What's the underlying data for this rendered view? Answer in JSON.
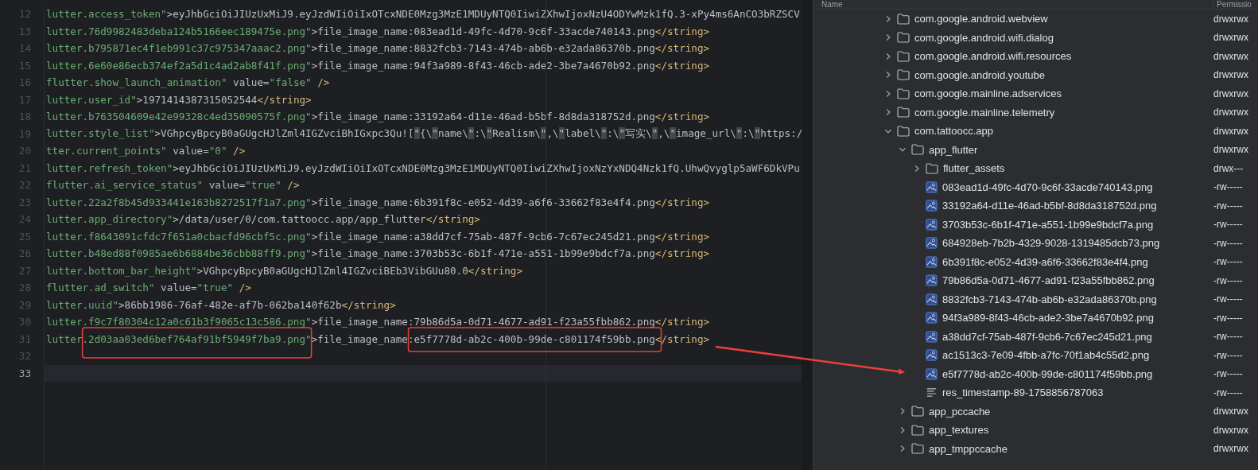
{
  "editor": {
    "lines": [
      {
        "number": "12",
        "current": false,
        "tokens": [
          {
            "kind": "attr",
            "text": "lutter.access_token\""
          },
          {
            "kind": "text",
            "text": ">eyJhbGciOiJIUzUxMiJ9.eyJzdWIiOiIxOTcxNDE0Mzg3MzE1MDUyNTQ0IiwiZXhwIjoxNzU4ODYwMzk1fQ.3-xPy4ms6AnCO3bRZSCV"
          }
        ]
      },
      {
        "number": "13",
        "current": false,
        "tokens": [
          {
            "kind": "attr",
            "text": "lutter.76d9982483deba124b5166eec189475e.png\""
          },
          {
            "kind": "text",
            "text": ">file_image_name:083ead1d-49fc-4d70-9c6f-33acde740143.png"
          },
          {
            "kind": "tag",
            "text": "</string>"
          }
        ]
      },
      {
        "number": "14",
        "current": false,
        "tokens": [
          {
            "kind": "attr",
            "text": "lutter.b795871ec4f1eb991c37c975347aaac2.png\""
          },
          {
            "kind": "text",
            "text": ">file_image_name:8832fcb3-7143-474b-ab6b-e32ada86370b.png"
          },
          {
            "kind": "tag",
            "text": "</string>"
          }
        ]
      },
      {
        "number": "15",
        "current": false,
        "tokens": [
          {
            "kind": "attr",
            "text": "lutter.6e60e86ecb374ef2a5d1c4ad2ab8f41f.png\""
          },
          {
            "kind": "text",
            "text": ">file_image_name:94f3a989-8f43-46cb-ade2-3be7a4670b92.png"
          },
          {
            "kind": "tag",
            "text": "</string>"
          }
        ]
      },
      {
        "number": "16",
        "current": false,
        "tokens": [
          {
            "kind": "attr",
            "text": "flutter.show_launch_animation\""
          },
          {
            "kind": "text",
            "text": " value="
          },
          {
            "kind": "attr",
            "text": "\"false\""
          },
          {
            "kind": "tag",
            "text": " />"
          }
        ]
      },
      {
        "number": "17",
        "current": false,
        "tokens": [
          {
            "kind": "attr",
            "text": "lutter.user_id\""
          },
          {
            "kind": "text",
            "text": ">1971414387315052544"
          },
          {
            "kind": "tag",
            "text": "</string>"
          }
        ]
      },
      {
        "number": "18",
        "current": false,
        "tokens": [
          {
            "kind": "attr",
            "text": "lutter.b763504609e42e99328c4ed35090575f.png\""
          },
          {
            "kind": "text",
            "text": ">file_image_name:33192a64-d11e-46ad-b5bf-8d8da318752d.png"
          },
          {
            "kind": "tag",
            "text": "</string>"
          }
        ]
      },
      {
        "number": "19",
        "current": false,
        "tokens": [
          {
            "kind": "attr",
            "text": "lutter.style_list\""
          },
          {
            "kind": "text",
            "text": ">VGhpcyBpcyB0aGUgcHJlZml4IGZvciBhIGxpc3Qu!["
          },
          {
            "kind": "esc",
            "text": "\""
          },
          {
            "kind": "text",
            "text": "{\\"
          },
          {
            "kind": "esc",
            "text": "\""
          },
          {
            "kind": "text",
            "text": "name\\"
          },
          {
            "kind": "esc",
            "text": "\""
          },
          {
            "kind": "text",
            "text": ":\\"
          },
          {
            "kind": "esc",
            "text": "\""
          },
          {
            "kind": "text",
            "text": "Realism\\"
          },
          {
            "kind": "esc",
            "text": "\""
          },
          {
            "kind": "text",
            "text": ",\\"
          },
          {
            "kind": "esc",
            "text": "\""
          },
          {
            "kind": "text",
            "text": "label\\"
          },
          {
            "kind": "esc",
            "text": "\""
          },
          {
            "kind": "text",
            "text": ":\\"
          },
          {
            "kind": "esc",
            "text": "\""
          },
          {
            "kind": "text",
            "text": "写实\\"
          },
          {
            "kind": "esc",
            "text": "\""
          },
          {
            "kind": "text",
            "text": ",\\"
          },
          {
            "kind": "esc",
            "text": "\""
          },
          {
            "kind": "text",
            "text": "image_url\\"
          },
          {
            "kind": "esc",
            "text": "\""
          },
          {
            "kind": "text",
            "text": ":\\"
          },
          {
            "kind": "esc",
            "text": "\""
          },
          {
            "kind": "text",
            "text": "https:/"
          }
        ]
      },
      {
        "number": "20",
        "current": false,
        "tokens": [
          {
            "kind": "attr",
            "text": "tter.current_points\""
          },
          {
            "kind": "text",
            "text": " value="
          },
          {
            "kind": "attr",
            "text": "\"0\""
          },
          {
            "kind": "tag",
            "text": " />"
          }
        ]
      },
      {
        "number": "21",
        "current": false,
        "tokens": [
          {
            "kind": "attr",
            "text": "lutter.refresh_token\""
          },
          {
            "kind": "text",
            "text": ">eyJhbGciOiJIUzUxMiJ9.eyJzdWIiOiIxOTcxNDE0Mzg3MzE1MDUyNTQ0IiwiZXhwIjoxNzYxNDQ4Nzk1fQ.UhwQvyglp5aWF6DkVPu"
          }
        ]
      },
      {
        "number": "22",
        "current": false,
        "tokens": [
          {
            "kind": "attr",
            "text": "flutter.ai_service_status\""
          },
          {
            "kind": "text",
            "text": " value="
          },
          {
            "kind": "attr",
            "text": "\"true\""
          },
          {
            "kind": "tag",
            "text": " />"
          }
        ]
      },
      {
        "number": "23",
        "current": false,
        "tokens": [
          {
            "kind": "attr",
            "text": "lutter.22a2f8b45d933441e163b8272517f1a7.png\""
          },
          {
            "kind": "text",
            "text": ">file_image_name:6b391f8c-e052-4d39-a6f6-33662f83e4f4.png"
          },
          {
            "kind": "tag",
            "text": "</string>"
          }
        ]
      },
      {
        "number": "24",
        "current": false,
        "tokens": [
          {
            "kind": "attr",
            "text": "lutter.app_directory\""
          },
          {
            "kind": "text",
            "text": ">/data/user/0/com.tattoocc.app/app_flutter"
          },
          {
            "kind": "tag",
            "text": "</string>"
          }
        ]
      },
      {
        "number": "25",
        "current": false,
        "tokens": [
          {
            "kind": "attr",
            "text": "lutter.f8643091cfdc7f651a0cbacfd96cbf5c.png\""
          },
          {
            "kind": "text",
            "text": ">file_image_name:a38dd7cf-75ab-487f-9cb6-7c67ec245d21.png"
          },
          {
            "kind": "tag",
            "text": "</string>"
          }
        ]
      },
      {
        "number": "26",
        "current": false,
        "tokens": [
          {
            "kind": "attr",
            "text": "lutter.b48ed88f0985ae6b6884be36cbb88ff9.png\""
          },
          {
            "kind": "text",
            "text": ">file_image_name:3703b53c-6b1f-471e-a551-1b99e9bdcf7a.png"
          },
          {
            "kind": "tag",
            "text": "</string>"
          }
        ]
      },
      {
        "number": "27",
        "current": false,
        "tokens": [
          {
            "kind": "attr",
            "text": "lutter.bottom_bar_height\""
          },
          {
            "kind": "text",
            "text": ">VGhpcyBpcyB0aGUgcHJlZml4IGZvciBEb3VibGUu80.0"
          },
          {
            "kind": "tag",
            "text": "</string>"
          }
        ]
      },
      {
        "number": "28",
        "current": false,
        "tokens": [
          {
            "kind": "attr",
            "text": "flutter.ad_switch\""
          },
          {
            "kind": "text",
            "text": " value="
          },
          {
            "kind": "attr",
            "text": "\"true\""
          },
          {
            "kind": "tag",
            "text": " />"
          }
        ]
      },
      {
        "number": "29",
        "current": false,
        "tokens": [
          {
            "kind": "attr",
            "text": "lutter.uuid\""
          },
          {
            "kind": "text",
            "text": ">86bb1986-76af-482e-af7b-062ba140f62b"
          },
          {
            "kind": "tag",
            "text": "</string>"
          }
        ]
      },
      {
        "number": "30",
        "current": false,
        "tokens": [
          {
            "kind": "attr",
            "text": "lutter.f9c7f80304c12a0c61b3f9065c13c586.png\""
          },
          {
            "kind": "text",
            "text": ">file_image_name:79b86d5a-0d71-4677-ad91-f23a55fbb862.png"
          },
          {
            "kind": "tag",
            "text": "</string>"
          }
        ]
      },
      {
        "number": "31",
        "current": false,
        "tokens": [
          {
            "kind": "attr",
            "text": "lutter.2d03aa03ed6bef764af91bf5949f7ba9.png\""
          },
          {
            "kind": "text",
            "text": ">file_image_name:e5f7778d-ab2c-400b-99de-c801174f59bb.png"
          },
          {
            "kind": "tag",
            "text": "</string>"
          }
        ]
      },
      {
        "number": "32",
        "current": false
      },
      {
        "number": "33",
        "current": true
      }
    ]
  },
  "file_tree": {
    "columns": [
      "Name",
      "Permissio"
    ],
    "items": [
      {
        "name": "com.google.android.webview",
        "kind": "folder",
        "expanded": false,
        "permissions": "drwxrwx"
      },
      {
        "name": "com.google.android.wifi.dialog",
        "kind": "folder",
        "expanded": false,
        "permissions": "drwxrwx"
      },
      {
        "name": "com.google.android.wifi.resources",
        "kind": "folder",
        "expanded": false,
        "permissions": "drwxrwx"
      },
      {
        "name": "com.google.android.youtube",
        "kind": "folder",
        "expanded": false,
        "permissions": "drwxrwx"
      },
      {
        "name": "com.google.mainline.adservices",
        "kind": "folder",
        "expanded": false,
        "permissions": "drwxrwx"
      },
      {
        "name": "com.google.mainline.telemetry",
        "kind": "folder",
        "expanded": false,
        "permissions": "drwxrwx"
      },
      {
        "name": "com.tattoocc.app",
        "kind": "folder",
        "expanded": true,
        "permissions": "drwxrwx",
        "children": [
          {
            "name": "app_flutter",
            "kind": "folder",
            "expanded": true,
            "permissions": "drwxrwx",
            "children": [
              {
                "name": "flutter_assets",
                "kind": "folder",
                "expanded": false,
                "permissions": "drwx---"
              },
              {
                "name": "083ead1d-49fc-4d70-9c6f-33acde740143.png",
                "kind": "image",
                "permissions": "-rw-----"
              },
              {
                "name": "33192a64-d11e-46ad-b5bf-8d8da318752d.png",
                "kind": "image",
                "permissions": "-rw-----"
              },
              {
                "name": "3703b53c-6b1f-471e-a551-1b99e9bdcf7a.png",
                "kind": "image",
                "permissions": "-rw-----"
              },
              {
                "name": "684928eb-7b2b-4329-9028-1319485dcb73.png",
                "kind": "image",
                "permissions": "-rw-----"
              },
              {
                "name": "6b391f8c-e052-4d39-a6f6-33662f83e4f4.png",
                "kind": "image",
                "permissions": "-rw-----"
              },
              {
                "name": "79b86d5a-0d71-4677-ad91-f23a55fbb862.png",
                "kind": "image",
                "permissions": "-rw-----"
              },
              {
                "name": "8832fcb3-7143-474b-ab6b-e32ada86370b.png",
                "kind": "image",
                "permissions": "-rw-----"
              },
              {
                "name": "94f3a989-8f43-46cb-ade2-3be7a4670b92.png",
                "kind": "image",
                "permissions": "-rw-----"
              },
              {
                "name": "a38dd7cf-75ab-487f-9cb6-7c67ec245d21.png",
                "kind": "image",
                "permissions": "-rw-----"
              },
              {
                "name": "ac1513c3-7e09-4fbb-a7fc-70f1ab4c55d2.png",
                "kind": "image",
                "permissions": "-rw-----"
              },
              {
                "name": "e5f7778d-ab2c-400b-99de-c801174f59bb.png",
                "kind": "image",
                "permissions": "-rw-----"
              },
              {
                "name": "res_timestamp-89-1758856787063",
                "kind": "text",
                "permissions": "-rw-----"
              }
            ]
          },
          {
            "name": "app_pccache",
            "kind": "folder",
            "expanded": false,
            "permissions": "drwxrwx"
          },
          {
            "name": "app_textures",
            "kind": "folder",
            "expanded": false,
            "permissions": "drwxrwx"
          },
          {
            "name": "app_tmppccache",
            "kind": "folder",
            "expanded": false,
            "permissions": "drwxrwx"
          }
        ]
      }
    ]
  }
}
